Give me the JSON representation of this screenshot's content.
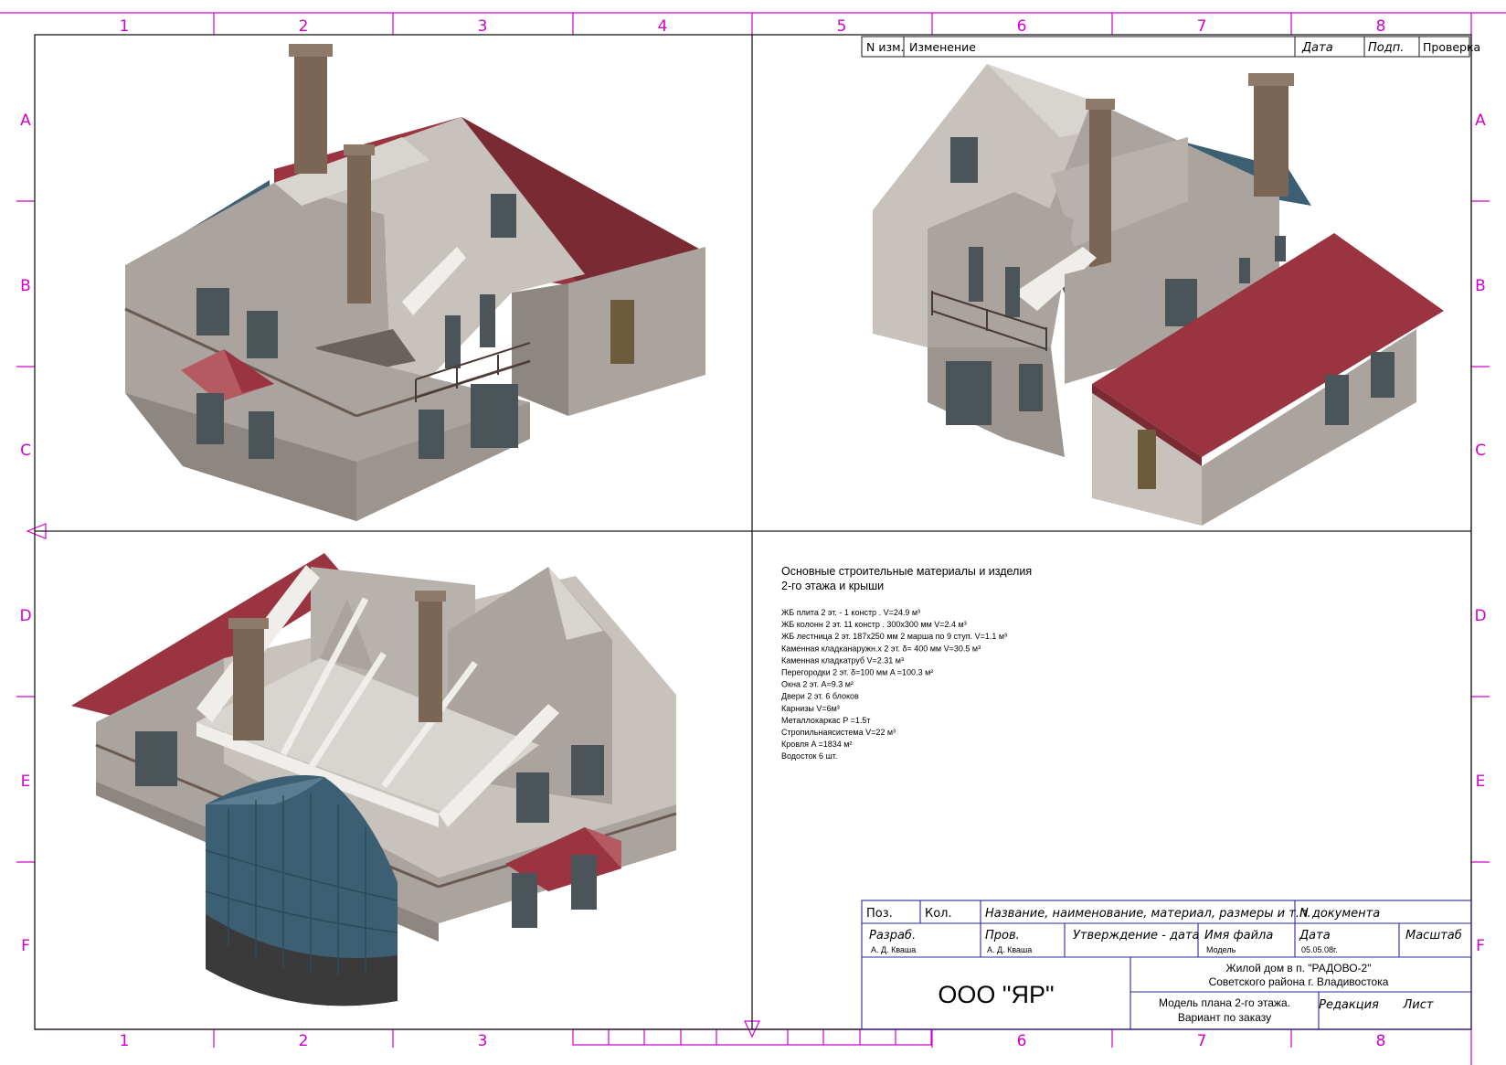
{
  "sheet": {
    "columns": [
      "1",
      "2",
      "3",
      "4",
      "5",
      "6",
      "7",
      "8"
    ],
    "rows": [
      "A",
      "B",
      "C",
      "D",
      "E",
      "F"
    ],
    "colors": {
      "grid": "#d000d0",
      "frame": "#1a1a1a",
      "title_block": "#2a2aa0",
      "wall": "#aba49e",
      "wall_dark": "#8e8781",
      "wall_light": "#c8c2bc",
      "roof": "#7a2a33",
      "roof_light": "#9a3440",
      "glass": "#3d5f73",
      "chimney": "#7b6656",
      "window": "#4a5459",
      "door": "#6d5c3c"
    }
  },
  "revision_table": {
    "headers": [
      "N изм.",
      "Изменение",
      "Дата",
      "Подп.",
      "Проверка"
    ]
  },
  "materials": {
    "title_line1": "Основные строительные материалы и изделия",
    "title_line2": "2-го этажа и крыши",
    "items": [
      "ЖБ плита 2 эт. - 1 констр . V=24.9 м³",
      "ЖБ колонн 2 эт. 11 констр . 300х300 мм    V=2.4 м³",
      "ЖБ лестница 2 эт. 187х250 мм 2 марша по 9 ступ. V=1.1 м³",
      "Каменная кладканаружн.х    2 эт. δ= 400 мм    V=30.5 м³",
      "Каменная кладкатруб    V=2.31 м³",
      "Перегородки   2 эт. δ=100 мм  A =100.3 м²",
      "Окна 2 эт.   A=9.3 м²",
      "Двери  2 эт.   6 блоков",
      "Карнизы   V=6м³",
      "Металлокаркас P  =1.5т",
      "Стропильнаясистема    V=22 м³",
      "Кровля  A =1834 м²",
      "Водосток   6 шт."
    ]
  },
  "title_block": {
    "pos": "Поз.",
    "kol": "Кол.",
    "name_header": "Название,  наименование,  материал,  размеры и т.п.",
    "doc_number": "N документа",
    "developed_label": "Разраб.",
    "developed_value": "А. Д. Кваша",
    "checked_label": "Пров.",
    "checked_value": "А. Д. Кваша",
    "approval_label": "Утверждение - дата",
    "file_label": "Имя файла",
    "file_value": "Модель",
    "date_label": "Дата",
    "date_value": "05.05.08г.",
    "scale_label": "Масштаб",
    "company": "ООО \"ЯР\"",
    "project_line1": "Жилой дом в п. \"РАДОВО-2\"",
    "project_line2": "Советского района г. Владивостока",
    "sheet_line1": "Модель плана 2-го этажа.",
    "sheet_line2": "Вариант по заказу",
    "edition_label": "Редакция",
    "sheet_label": "Лист"
  }
}
